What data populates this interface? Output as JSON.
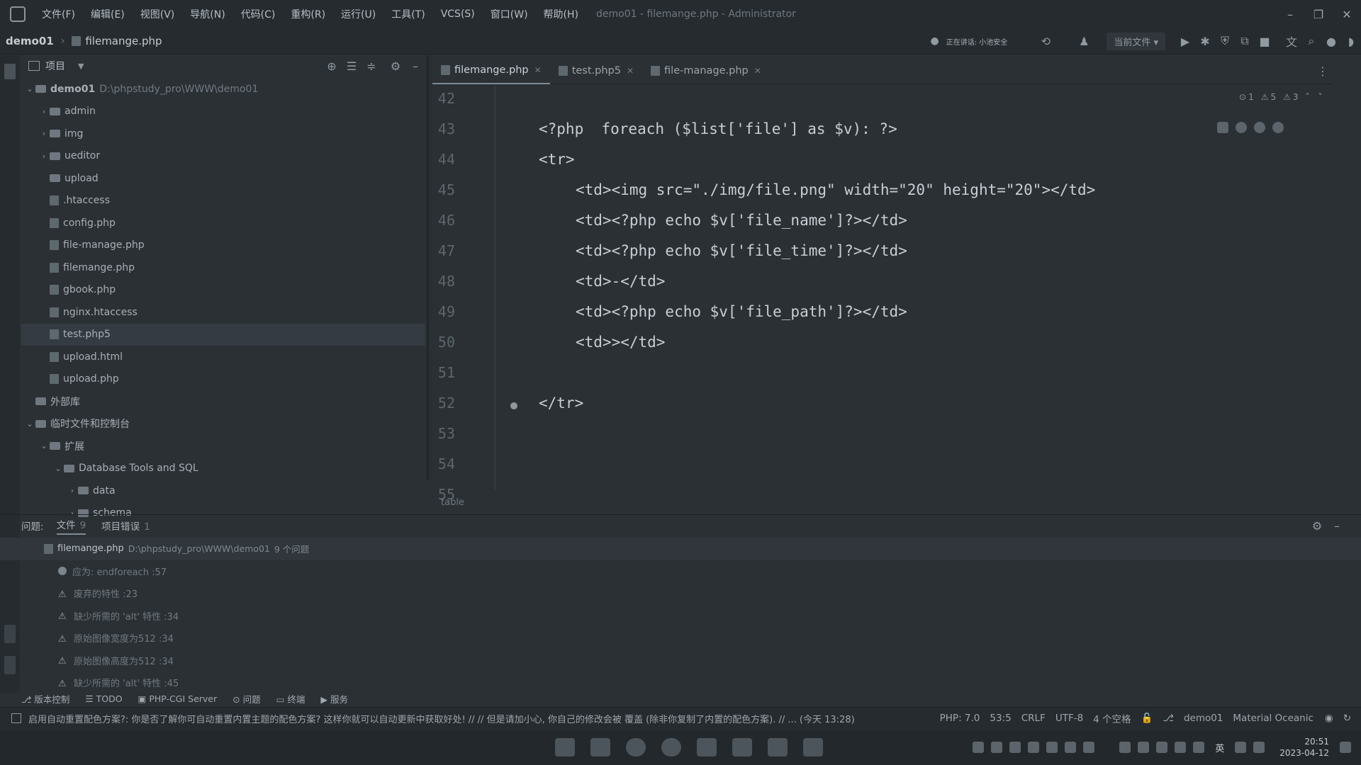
{
  "menu": {
    "items": [
      "文件(F)",
      "编辑(E)",
      "视图(V)",
      "导航(N)",
      "代码(C)",
      "重构(R)",
      "运行(U)",
      "工具(T)",
      "VCS(S)",
      "窗口(W)",
      "帮助(H)"
    ],
    "window_title": "demo01 - filemange.php - Administrator"
  },
  "nav": {
    "project": "demo01",
    "file": "filemange.php",
    "speaking": "正在讲话: 小池安全",
    "run_config": "当前文件"
  },
  "project_panel": {
    "title": "项目",
    "tree": [
      {
        "label": "demo01",
        "path": "D:\\phpstudy_pro\\WWW\\demo01",
        "type": "folder",
        "depth": 0,
        "expanded": true
      },
      {
        "label": "admin",
        "type": "folder",
        "depth": 1,
        "expanded": false
      },
      {
        "label": "img",
        "type": "folder",
        "depth": 1,
        "expanded": false
      },
      {
        "label": "ueditor",
        "type": "folder",
        "depth": 1,
        "expanded": false
      },
      {
        "label": "upload",
        "type": "folder",
        "depth": 1
      },
      {
        "label": ".htaccess",
        "type": "file",
        "depth": 1
      },
      {
        "label": "config.php",
        "type": "file",
        "depth": 1
      },
      {
        "label": "file-manage.php",
        "type": "file",
        "depth": 1
      },
      {
        "label": "filemange.php",
        "type": "file",
        "depth": 1
      },
      {
        "label": "gbook.php",
        "type": "file",
        "depth": 1
      },
      {
        "label": "nginx.htaccess",
        "type": "file",
        "depth": 1
      },
      {
        "label": "test.php5",
        "type": "file",
        "depth": 1,
        "selected": true
      },
      {
        "label": "upload.html",
        "type": "file",
        "depth": 1
      },
      {
        "label": "upload.php",
        "type": "file",
        "depth": 1
      },
      {
        "label": "外部库",
        "type": "lib",
        "depth": 0
      },
      {
        "label": "临时文件和控制台",
        "type": "folder",
        "depth": 0,
        "expanded": true
      },
      {
        "label": "扩展",
        "type": "folder",
        "depth": 1,
        "expanded": true
      },
      {
        "label": "Database Tools and SQL",
        "type": "folder",
        "depth": 2,
        "expanded": true
      },
      {
        "label": "data",
        "type": "folder",
        "depth": 3,
        "expanded": false
      },
      {
        "label": "schema",
        "type": "folder",
        "depth": 3,
        "expanded": false
      }
    ]
  },
  "editor": {
    "tabs": [
      {
        "label": "filemange.php",
        "active": true
      },
      {
        "label": "test.php5",
        "active": false
      },
      {
        "label": "file-manage.php",
        "active": false
      }
    ],
    "inspections": {
      "errors": "1",
      "warnings": "5",
      "weak": "3"
    },
    "line_numbers": [
      "42",
      "43",
      "44",
      "45",
      "46",
      "47",
      "48",
      "49",
      "50",
      "51",
      "52",
      "53",
      "54",
      "55"
    ],
    "code_lines": [
      {
        "indent": 0,
        "text": ""
      },
      {
        "indent": 1,
        "text": "<?php  foreach ($list['file'] as $v): ?>"
      },
      {
        "indent": 1,
        "text": "<tr>"
      },
      {
        "indent": 2,
        "text": "<td><img src=\"./img/file.png\" width=\"20\" height=\"20\"></td>"
      },
      {
        "indent": 2,
        "text": "<td><?php echo $v['file_name']?></td>"
      },
      {
        "indent": 2,
        "text": "<td><?php echo $v['file_time']?></td>"
      },
      {
        "indent": 2,
        "text": "<td>-</td>"
      },
      {
        "indent": 2,
        "text": "<td><?php echo $v['file_path']?></td>"
      },
      {
        "indent": 2,
        "text": "<td>></td>"
      },
      {
        "indent": 0,
        "text": ""
      },
      {
        "indent": 1,
        "text": "</tr>"
      },
      {
        "indent": 0,
        "text": ""
      },
      {
        "indent": 0,
        "text": ""
      },
      {
        "indent": 0,
        "text": ""
      }
    ],
    "breadcrumb": "table"
  },
  "problems": {
    "title": "问题:",
    "tabs": [
      {
        "label": "文件",
        "count": "9"
      },
      {
        "label": "项目错误",
        "count": "1"
      }
    ],
    "file": {
      "name": "filemange.php",
      "path": "D:\\phpstudy_pro\\WWW\\demo01",
      "summary": "9 个问题"
    },
    "items": [
      {
        "level": "error",
        "text": "应为: endforeach :57"
      },
      {
        "level": "warning",
        "text": "废弃的特性 :23"
      },
      {
        "level": "warning",
        "text": "缺少所需的 'alt' 特性 :34"
      },
      {
        "level": "warning",
        "text": "原始图像宽度为512 :34"
      },
      {
        "level": "warning",
        "text": "原始图像高度为512 :34"
      },
      {
        "level": "warning",
        "text": "缺少所需的 'alt' 特性 :45"
      }
    ]
  },
  "toolstrip": [
    "版本控制",
    "TODO",
    "PHP-CGI Server",
    "问题",
    "终端",
    "服务"
  ],
  "statusbar": {
    "message": "启用自动重置配色方案?: 你是否了解你可自动重置内置主题的配色方案? 这样你就可以自动更新中获取好处! // // 但是请加小心, 你自己的修改会被 覆盖 (除非你复制了内置的配色方案). // ... (今天 13:28)",
    "php": "PHP: 7.0",
    "position": "53:5",
    "line_sep": "CRLF",
    "encoding": "UTF-8",
    "indent": "4 个空格",
    "project": "demo01",
    "theme": "Material Oceanic"
  },
  "taskbar": {
    "ime": "英",
    "time": "20:51",
    "date": "2023-04-12"
  }
}
